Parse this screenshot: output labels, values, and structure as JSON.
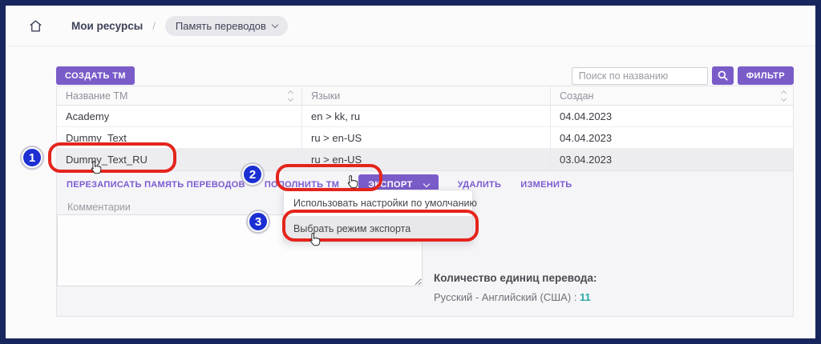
{
  "colors": {
    "frame_navy": "#18265e",
    "accent_purple": "#7a5cc9",
    "annotation_red": "#e4251c",
    "annotation_blue": "#1b2fd2",
    "count_teal": "#2aa7a0"
  },
  "breadcrumb": {
    "home_icon": "home-icon",
    "root": "Мои ресурсы",
    "separator": "/",
    "current": "Память переводов"
  },
  "toolbar": {
    "create_button": "СОЗДАТЬ ТМ",
    "search_placeholder": "Поиск по названию",
    "filter_button": "ФИЛЬТР"
  },
  "table": {
    "columns": {
      "name": "Название ТМ",
      "languages": "Языки",
      "created": "Создан"
    },
    "rows": [
      {
        "name": "Academy",
        "languages": "en > kk, ru",
        "created": "04.04.2023"
      },
      {
        "name": "Dummy_Text",
        "languages": "ru > en-US",
        "created": "04.04.2023"
      },
      {
        "name": "Dummy_Text_RU",
        "languages": "ru > en-US",
        "created": "03.04.2023"
      }
    ]
  },
  "actions": {
    "overwrite": "ПЕРЕЗАПИСАТЬ ПАМЯТЬ ПЕРЕВОДОВ",
    "replenish": "ПОПОЛНИТЬ ТМ",
    "export": "ЭКСПОРТ",
    "delete": "УДАЛИТЬ",
    "edit": "ИЗМЕНИТЬ"
  },
  "export_menu": {
    "items": [
      "Использовать настройки по умолчанию",
      "Выбрать режим экспорта"
    ]
  },
  "details": {
    "comments_label": "Комментарии",
    "comments_value": "",
    "units_title": "Количество единиц перевода:",
    "units_pair": "Русский - Английский (США) :",
    "units_count": "11"
  },
  "annotations": {
    "step1": "1",
    "step2": "2",
    "step3": "3"
  }
}
